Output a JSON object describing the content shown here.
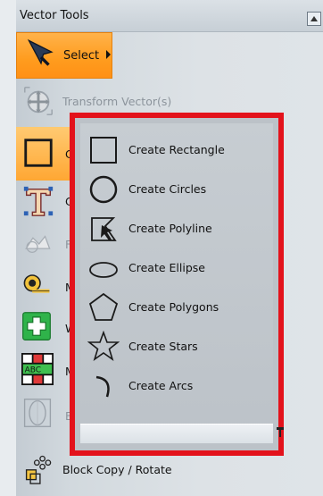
{
  "panel": {
    "title": "Vector Tools",
    "tools": {
      "select": "Select",
      "transform": "Transform Vector(s)",
      "rect_partial": "C",
      "text_partial": "C",
      "faded_partial": "F",
      "measure_partial": "M",
      "weld_partial": "W",
      "text_tool_partial": "M",
      "erase_partial": "E",
      "block_copy": "Block Copy / Rotate"
    }
  },
  "flyout": {
    "items": [
      {
        "label": "Create Rectangle",
        "icon": "rectangle-icon"
      },
      {
        "label": "Create Circles",
        "icon": "circle-icon"
      },
      {
        "label": "Create Polyline",
        "icon": "polyline-icon"
      },
      {
        "label": "Create Ellipse",
        "icon": "ellipse-icon"
      },
      {
        "label": "Create Polygons",
        "icon": "polygon-icon"
      },
      {
        "label": "Create Stars",
        "icon": "star-icon"
      },
      {
        "label": "Create Arcs",
        "icon": "arc-icon"
      }
    ]
  },
  "colors": {
    "highlight": "#e3121b",
    "active_tool": "#ff9c1e"
  }
}
